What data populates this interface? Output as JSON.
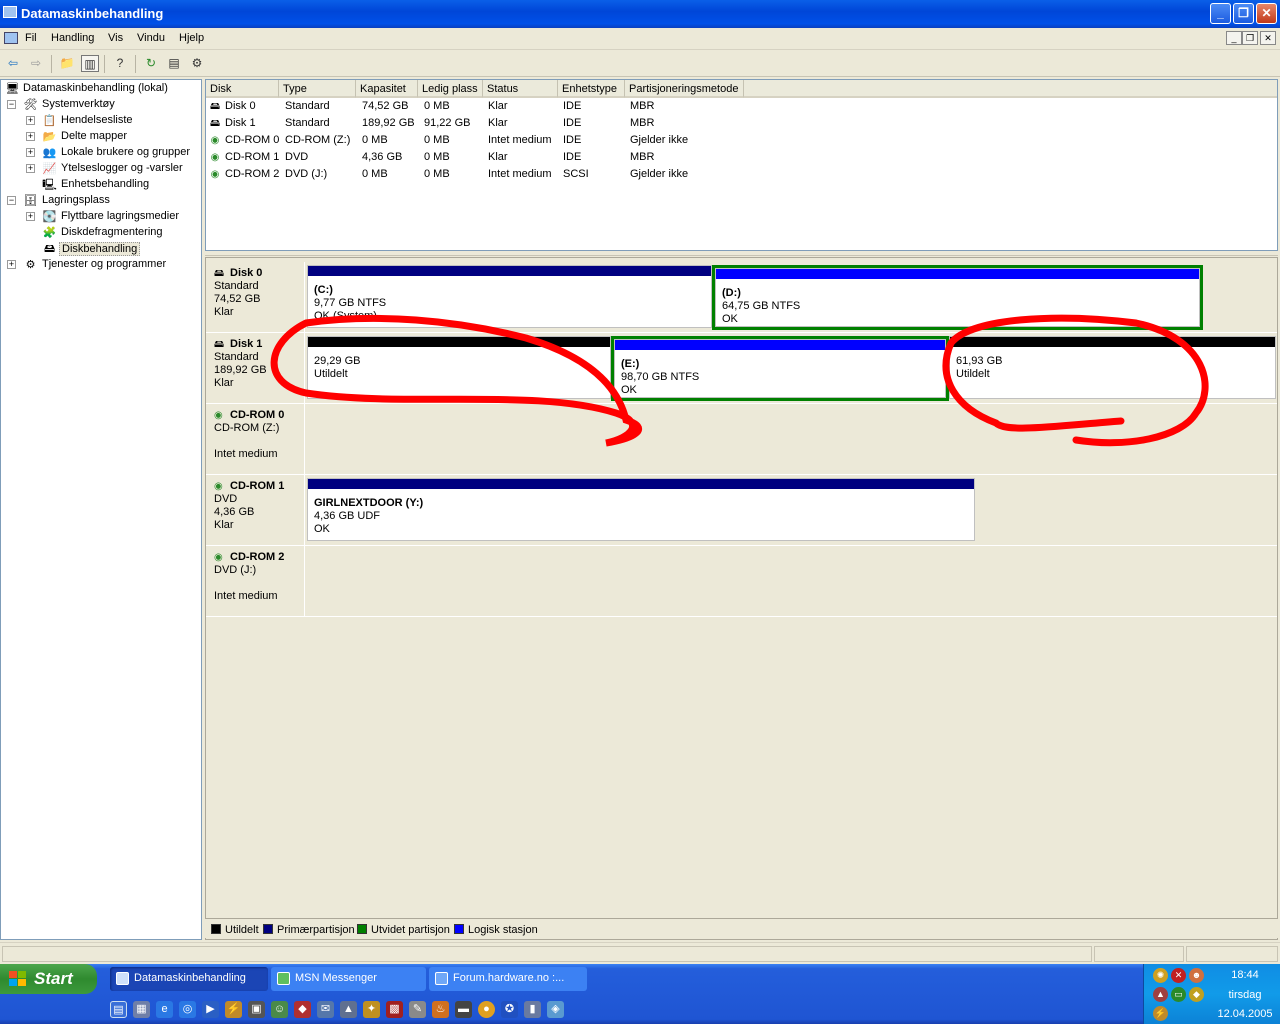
{
  "window": {
    "title": "Datamaskinbehandling"
  },
  "menu": [
    "Fil",
    "Handling",
    "Vis",
    "Vindu",
    "Hjelp"
  ],
  "tree": {
    "root": "Datamaskinbehandling (lokal)",
    "items": [
      {
        "label": "Systemverktøy"
      },
      {
        "label": "Hendelsesliste"
      },
      {
        "label": "Delte mapper"
      },
      {
        "label": "Lokale brukere og grupper"
      },
      {
        "label": "Ytelseslogger og -varsler"
      },
      {
        "label": "Enhetsbehandling"
      },
      {
        "label": "Lagringsplass"
      },
      {
        "label": "Flyttbare lagringsmedier"
      },
      {
        "label": "Diskdefragmentering"
      },
      {
        "label": "Diskbehandling"
      },
      {
        "label": "Tjenester og programmer"
      }
    ]
  },
  "volume_list": {
    "columns": [
      "Disk",
      "Type",
      "Kapasitet",
      "Ledig plass",
      "Status",
      "Enhetstype",
      "Partisjoneringsmetode"
    ],
    "rows": [
      [
        "Disk 0",
        "Standard",
        "74,52 GB",
        "0 MB",
        "Klar",
        "IDE",
        "MBR"
      ],
      [
        "Disk 1",
        "Standard",
        "189,92 GB",
        "91,22 GB",
        "Klar",
        "IDE",
        "MBR"
      ],
      [
        "CD-ROM 0",
        "CD-ROM (Z:)",
        "0 MB",
        "0 MB",
        "Intet medium",
        "IDE",
        "Gjelder ikke"
      ],
      [
        "CD-ROM 1",
        "DVD",
        "4,36 GB",
        "0 MB",
        "Klar",
        "IDE",
        "MBR"
      ],
      [
        "CD-ROM 2",
        "DVD (J:)",
        "0 MB",
        "0 MB",
        "Intet medium",
        "SCSI",
        "Gjelder ikke"
      ]
    ]
  },
  "disks": [
    {
      "name": "Disk 0",
      "l1": "Standard",
      "l2": "74,52 GB",
      "l3": "Klar",
      "parts": [
        {
          "name": "(C:)",
          "size": "9,77 GB NTFS",
          "status": "OK (System)"
        },
        {
          "name": "(D:)",
          "size": "64,75 GB NTFS",
          "status": "OK"
        }
      ]
    },
    {
      "name": "Disk 1",
      "l1": "Standard",
      "l2": "189,92 GB",
      "l3": "Klar",
      "parts": [
        {
          "name": "",
          "size": "29,29 GB",
          "status": "Utildelt"
        },
        {
          "name": "(E:)",
          "size": "98,70 GB NTFS",
          "status": "OK"
        },
        {
          "name": "",
          "size": "61,93 GB",
          "status": "Utildelt"
        }
      ]
    },
    {
      "name": "CD-ROM 0",
      "l1": "CD-ROM (Z:)",
      "l2": "",
      "l3": "Intet medium",
      "parts": []
    },
    {
      "name": "CD-ROM 1",
      "l1": "DVD",
      "l2": "4,36 GB",
      "l3": "Klar",
      "parts": [
        {
          "name": "GIRLNEXTDOOR  (Y:)",
          "size": "4,36 GB UDF",
          "status": "OK"
        }
      ]
    },
    {
      "name": "CD-ROM 2",
      "l1": "DVD (J:)",
      "l2": "",
      "l3": "Intet medium",
      "parts": []
    }
  ],
  "legend": [
    {
      "label": "Utildelt",
      "color": "#000000"
    },
    {
      "label": "Primærpartisjon",
      "color": "#000080"
    },
    {
      "label": "Utvidet partisjon",
      "color": "#008000"
    },
    {
      "label": "Logisk stasjon",
      "color": "#0000ff"
    }
  ],
  "colors": {
    "primary": "#000080",
    "unallocated": "#000000",
    "extended": "#008000",
    "logical": "#0000ff",
    "annotation": "#ff0000"
  },
  "taskbar": {
    "start": "Start",
    "tasks": [
      "Datamaskinbehandling",
      "MSN Messenger",
      "Forum.hardware.no :..."
    ],
    "clock": {
      "time": "18:44",
      "day": "tirsdag",
      "date": "12.04.2005"
    }
  }
}
